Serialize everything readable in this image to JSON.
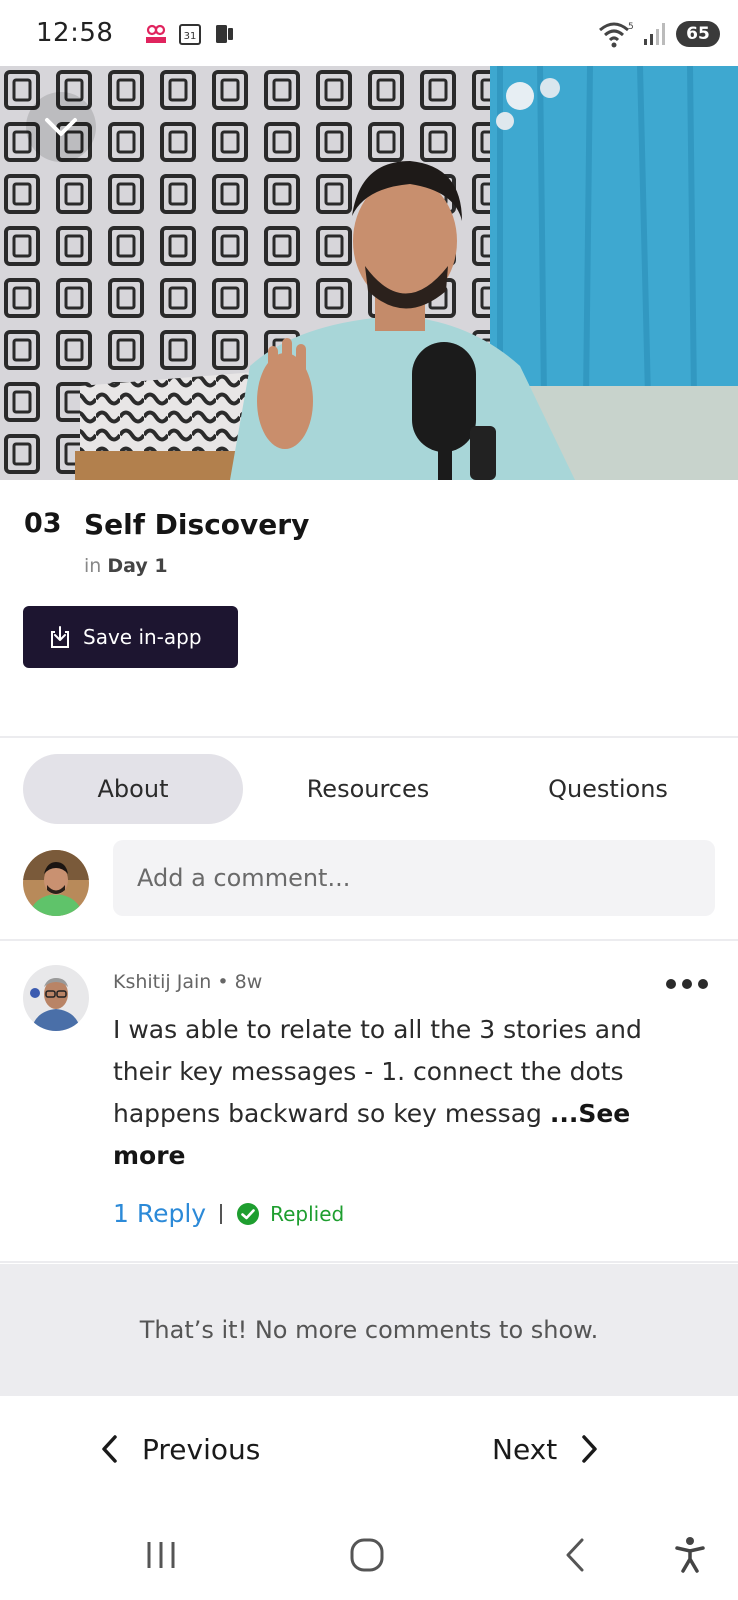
{
  "status_bar": {
    "time": "12:58",
    "battery": "65",
    "left_icons": [
      "hood-app-icon",
      "calendar-31-icon",
      "phone-icon"
    ],
    "right_icons": [
      "wifi-icon",
      "signal-icon",
      "battery-icon"
    ]
  },
  "video": {
    "collapse_icon": "chevron-down-icon"
  },
  "lesson": {
    "number": "03",
    "title": "Self Discovery",
    "context_prefix": "in",
    "context_value": "Day 1",
    "save_label": "Save in-app"
  },
  "tabs": [
    {
      "label": "About",
      "active": true
    },
    {
      "label": "Resources",
      "active": false
    },
    {
      "label": "Questions",
      "active": false
    }
  ],
  "comment_box": {
    "placeholder": "Add a comment..."
  },
  "comment": {
    "author": "Kshitij Jain",
    "separator": "•",
    "age": "8w",
    "text": "I was able to relate to all the 3 stories and their key messages - 1. connect the dots happens backward so key messag ",
    "see_more": "...See more",
    "reply_count": "1 Reply",
    "replied_label": "Replied"
  },
  "end_message": "That’s it! No more comments to show.",
  "pager": {
    "previous": "Previous",
    "next": "Next"
  },
  "colors": {
    "save_button_bg": "#1d1530",
    "active_tab_bg": "#e3e2e8",
    "reply_link": "#2c8ad8",
    "replied_green": "#1e9e2f"
  }
}
